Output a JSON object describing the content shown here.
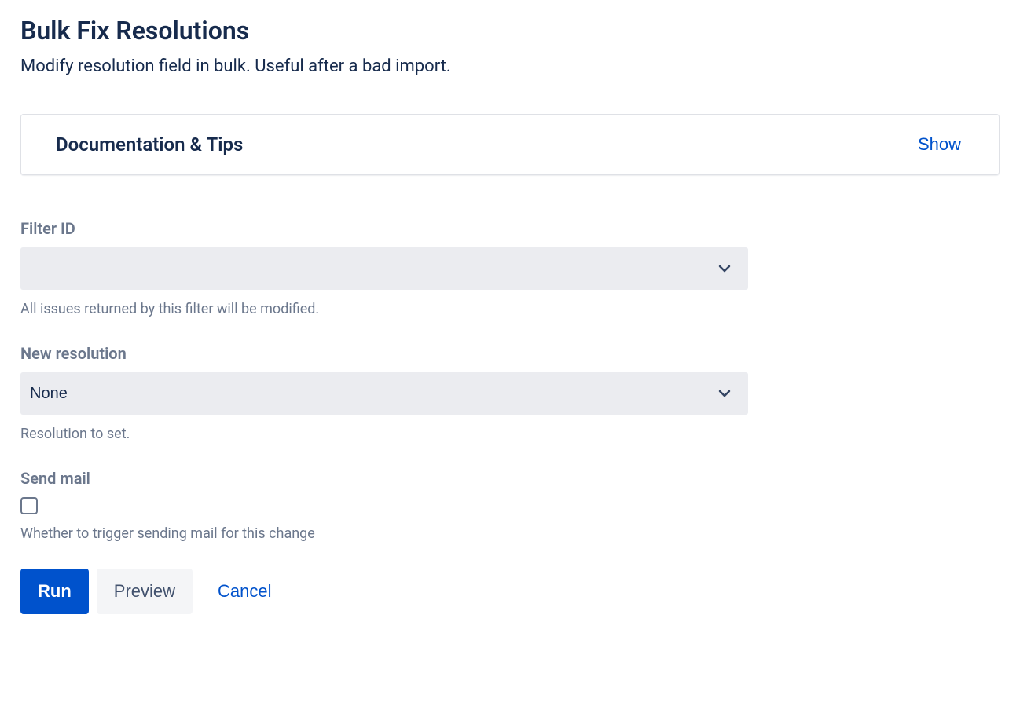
{
  "page": {
    "title": "Bulk Fix Resolutions",
    "subtitle": "Modify resolution field in bulk. Useful after a bad import."
  },
  "docPanel": {
    "title": "Documentation & Tips",
    "toggle": "Show"
  },
  "form": {
    "filterId": {
      "label": "Filter ID",
      "value": "",
      "help": "All issues returned by this filter will be modified."
    },
    "newResolution": {
      "label": "New resolution",
      "value": "None",
      "help": "Resolution to set."
    },
    "sendMail": {
      "label": "Send mail",
      "checked": false,
      "help": "Whether to trigger sending mail for this change"
    }
  },
  "buttons": {
    "run": "Run",
    "preview": "Preview",
    "cancel": "Cancel"
  }
}
